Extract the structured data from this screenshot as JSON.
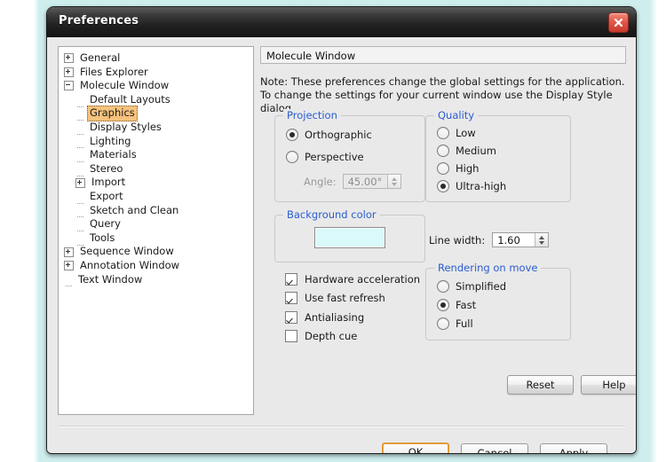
{
  "window": {
    "title": "Preferences",
    "close_icon": "close-icon"
  },
  "tree": {
    "items": [
      {
        "label": "General",
        "indent": 0,
        "toggle": "plus",
        "selected": false
      },
      {
        "label": "Files Explorer",
        "indent": 0,
        "toggle": "plus",
        "selected": false
      },
      {
        "label": "Molecule Window",
        "indent": 0,
        "toggle": "minus",
        "selected": false
      },
      {
        "label": "Default Layouts",
        "indent": 1,
        "toggle": "none",
        "selected": false
      },
      {
        "label": "Graphics",
        "indent": 1,
        "toggle": "none",
        "selected": true
      },
      {
        "label": "Display Styles",
        "indent": 1,
        "toggle": "none",
        "selected": false
      },
      {
        "label": "Lighting",
        "indent": 1,
        "toggle": "none",
        "selected": false
      },
      {
        "label": "Materials",
        "indent": 1,
        "toggle": "none",
        "selected": false
      },
      {
        "label": "Stereo",
        "indent": 1,
        "toggle": "none",
        "selected": false
      },
      {
        "label": "Import",
        "indent": 1,
        "toggle": "plus",
        "selected": false
      },
      {
        "label": "Export",
        "indent": 1,
        "toggle": "none",
        "selected": false
      },
      {
        "label": "Sketch and Clean",
        "indent": 1,
        "toggle": "none",
        "selected": false
      },
      {
        "label": "Query",
        "indent": 1,
        "toggle": "none",
        "selected": false
      },
      {
        "label": "Tools",
        "indent": 1,
        "toggle": "none",
        "selected": false
      },
      {
        "label": "Sequence Window",
        "indent": 0,
        "toggle": "plus",
        "selected": false
      },
      {
        "label": "Annotation Window",
        "indent": 0,
        "toggle": "plus",
        "selected": false
      },
      {
        "label": "Text Window",
        "indent": 0,
        "toggle": "none",
        "selected": false
      }
    ]
  },
  "content": {
    "page_title": "Molecule Window",
    "note_line1": "Note: These preferences change the global settings for the application.",
    "note_line2": "To change the settings for your current window use the Display Style dialog."
  },
  "projection": {
    "legend": "Projection",
    "options": [
      {
        "label": "Orthographic",
        "selected": true
      },
      {
        "label": "Perspective",
        "selected": false
      }
    ],
    "angle_label": "Angle:",
    "angle_value": "45.00°",
    "angle_enabled": false
  },
  "quality": {
    "legend": "Quality",
    "options": [
      {
        "label": "Low",
        "selected": false
      },
      {
        "label": "Medium",
        "selected": false
      },
      {
        "label": "High",
        "selected": false
      },
      {
        "label": "Ultra-high",
        "selected": true
      }
    ]
  },
  "background_color": {
    "legend": "Background color",
    "swatch_hex": "#d9f9fb"
  },
  "line_width": {
    "label": "Line width:",
    "value": "1.60"
  },
  "options": {
    "checkboxes": [
      {
        "label": "Hardware acceleration",
        "checked": true
      },
      {
        "label": "Use fast refresh",
        "checked": true
      },
      {
        "label": "Antialiasing",
        "checked": true
      },
      {
        "label": "Depth cue",
        "checked": false
      }
    ]
  },
  "rendering_on_move": {
    "legend": "Rendering on move",
    "options": [
      {
        "label": "Simplified",
        "selected": false
      },
      {
        "label": "Fast",
        "selected": true
      },
      {
        "label": "Full",
        "selected": false
      }
    ]
  },
  "buttons": {
    "reset": "Reset",
    "help": "Help",
    "ok": "OK",
    "cancel": "Cancel",
    "apply": "Apply"
  },
  "colors": {
    "group_legend": "#2a5cd0",
    "selection_highlight": "#f6c27c",
    "focus_border": "#e09a3a",
    "close_button": "#c7392c"
  }
}
